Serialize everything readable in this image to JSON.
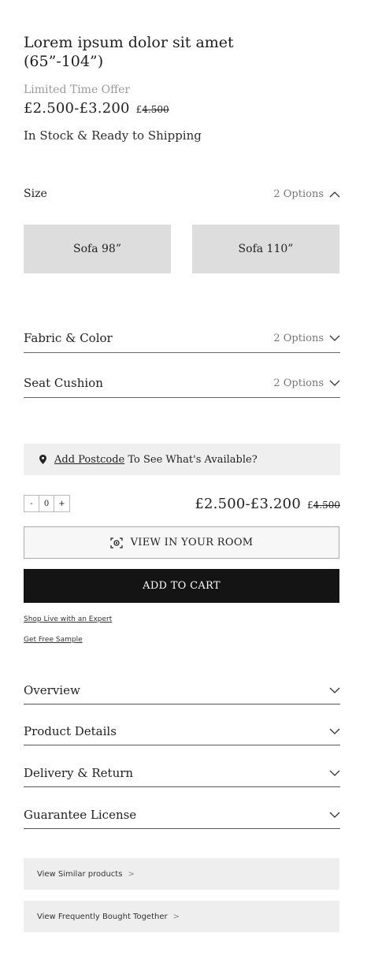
{
  "product": {
    "title": "Lorem ipsum dolor sit amet (65”-104”)",
    "offer": "Limited Time Offer",
    "price_range": "£2.500-£3.200",
    "old_price_currency": "£",
    "old_price": "4.500",
    "stock": "In Stock & Ready to Shipping"
  },
  "size": {
    "label": "Size",
    "options_count": "2 Options",
    "options": [
      "Sofa 98”",
      "Sofa 110”"
    ]
  },
  "fabric": {
    "label": "Fabric & Color",
    "options_count": "2 Options"
  },
  "seat": {
    "label": "Seat Cushion",
    "options_count": "2 Options"
  },
  "postcode": {
    "link": "Add Postcode",
    "text": "To See What's Available?"
  },
  "quantity": {
    "minus": "-",
    "value": "0",
    "plus": "+"
  },
  "buttons": {
    "view_room": "VIEW IN YOUR ROOM",
    "add_to_cart": "ADD TO CART"
  },
  "links": {
    "expert": "Shop Live with an Expert",
    "sample": "Get Free Sample"
  },
  "sections": [
    "Overview",
    "Product Details",
    "Delivery & Return",
    "Guarantee License"
  ],
  "related": {
    "similar": "View Similar products",
    "bought_together": "View Frequently Bought Together",
    "arrow": ">"
  },
  "icons": [
    "chevron-up-icon",
    "chevron-down-icon",
    "location-pin-icon",
    "ar-camera-icon"
  ]
}
